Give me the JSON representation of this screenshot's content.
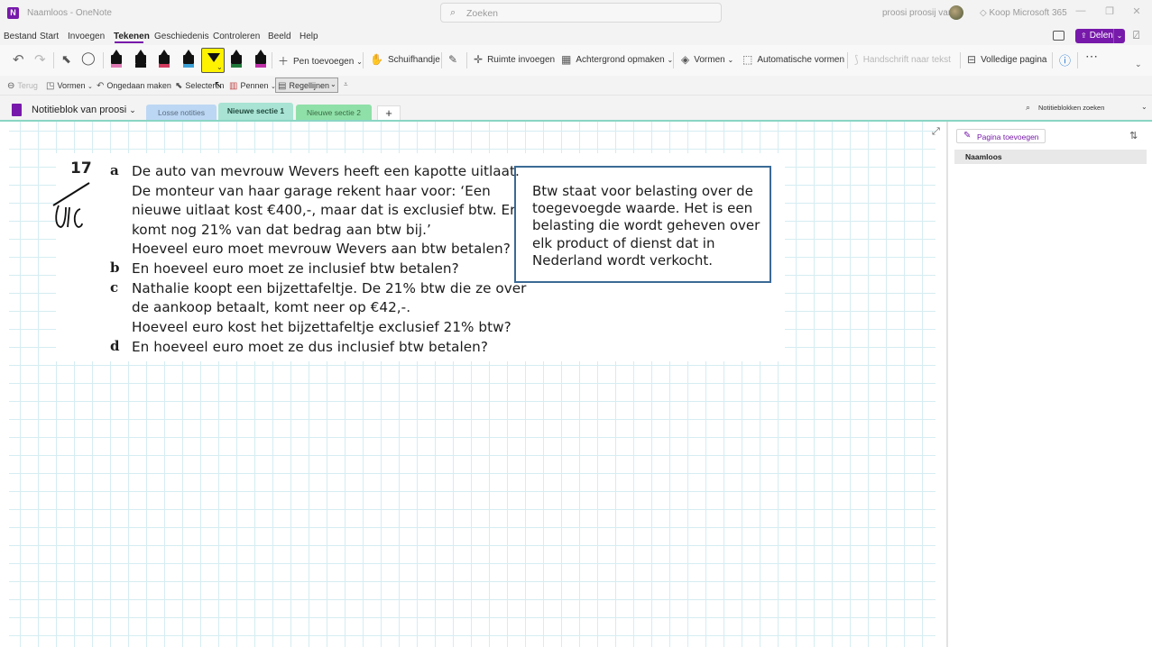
{
  "window": {
    "logo": "N",
    "title": "Naamloos - OneNote",
    "search_placeholder": "Zoeken",
    "user_name": "proosi proosij van",
    "buy_label": "Koop Microsoft 365",
    "buy_icon": "diamond-icon",
    "minimize": "—",
    "restore": "❐",
    "close": "✕"
  },
  "menu": {
    "items": [
      "Bestand",
      "Start",
      "Invoegen",
      "Tekenen",
      "Geschiedenis",
      "Controleren",
      "Beeld",
      "Help"
    ],
    "active": "Tekenen",
    "share_label": "Delen",
    "accent": "#7719aa"
  },
  "ribbon": {
    "pen_toevoegen": "Pen toevoegen",
    "schuifhandje": "Schuifhandje",
    "ruimte_invoegen": "Ruimte invoegen",
    "achtergrond": "Achtergrond opmaken",
    "vormen": "Vormen",
    "automatische_vormen": "Automatische vormen",
    "handschrift": "Handschrift naar tekst",
    "volledige_pagina": "Volledige pagina",
    "pen_colors": [
      "#e07ab5",
      "#111111",
      "#d23a5e",
      "#3aa0d6",
      "#fff200",
      "#1f7a3a",
      "#c02fa8"
    ]
  },
  "quick_access": {
    "terug": "Terug",
    "vormen": "Vormen",
    "ongedaan": "Ongedaan maken",
    "selecteren": "Selecteren",
    "pennen": "Pennen",
    "regellijnen": "Regellijnen"
  },
  "notebook": {
    "name": "Notitieblok van proosi",
    "tabs": [
      {
        "label": "Losse notities",
        "color": "#bcd7f3"
      },
      {
        "label": "Nieuwe sectie 1",
        "color": "#a8e3d3"
      },
      {
        "label": "Nieuwe sectie 2",
        "color": "#8fe0a8"
      }
    ],
    "add_tab": "+",
    "search_placeholder": "Notitieblokken zoeken"
  },
  "content": {
    "question_number": "17",
    "lines": [
      {
        "letter": "a",
        "text": "De auto van mevrouw Wevers heeft een kapotte uitlaat."
      },
      {
        "letter": "",
        "text": "De monteur van haar garage rekent haar voor: ‘Een"
      },
      {
        "letter": "",
        "text": "nieuwe uitlaat kost €400,-, maar dat is exclusief btw. Er"
      },
      {
        "letter": "",
        "text": "komt nog 21% van dat bedrag aan btw bij.’"
      },
      {
        "letter": "",
        "text": "Hoeveel euro moet mevrouw Wevers aan btw betalen?"
      },
      {
        "letter": "b",
        "text": "En hoeveel euro moet ze inclusief btw betalen?"
      },
      {
        "letter": "c",
        "text": "Nathalie koopt een bijzettafeltje. De 21% btw die ze over"
      },
      {
        "letter": "",
        "text": "de aankoop betaalt, komt neer op €42,-."
      },
      {
        "letter": "",
        "text": "Hoeveel euro kost het bijzettafeltje exclusief 21% btw?"
      },
      {
        "letter": "d",
        "text": "En hoeveel euro moet ze dus inclusief btw betalen?"
      }
    ],
    "info_box": [
      "Btw staat voor belasting over de",
      "toegevoegde waarde. Het is een",
      "belasting die wordt geheven over",
      "elk product of dienst dat in",
      "Nederland wordt verkocht."
    ]
  },
  "pages_panel": {
    "add_page": "Pagina toevoegen",
    "pages": [
      "Naamloos"
    ]
  }
}
